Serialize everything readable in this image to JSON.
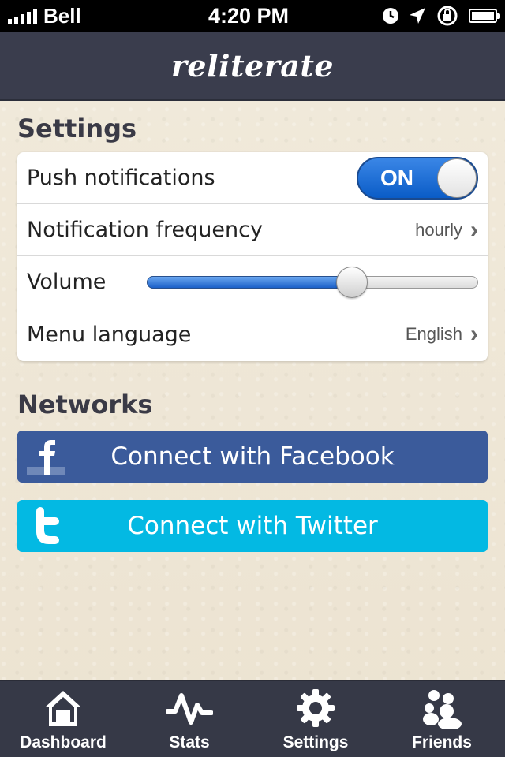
{
  "status_bar": {
    "carrier": "Bell",
    "time": "4:20 PM",
    "icons": [
      "alarm-icon",
      "location-icon",
      "rotation-lock-icon",
      "battery-icon"
    ]
  },
  "header": {
    "title": "reliterate",
    "color": "#3a3d4d"
  },
  "settings": {
    "title": "Settings",
    "push_notifications": {
      "label": "Push notifications",
      "state": "ON",
      "enabled": true
    },
    "notification_frequency": {
      "label": "Notification frequency",
      "value": "hourly"
    },
    "volume": {
      "label": "Volume",
      "level": 0.62
    },
    "menu_language": {
      "label": "Menu language",
      "value": "English"
    }
  },
  "networks": {
    "title": "Networks",
    "facebook": {
      "label": "Connect with Facebook",
      "color": "#3b5b9b",
      "icon": "facebook-icon"
    },
    "twitter": {
      "label": "Connect with Twitter",
      "color": "#03b9e3",
      "icon": "twitter-icon"
    }
  },
  "tabbar": {
    "tabs": [
      {
        "label": "Dashboard",
        "icon": "home-icon"
      },
      {
        "label": "Stats",
        "icon": "pulse-icon"
      },
      {
        "label": "Settings",
        "icon": "gear-icon",
        "active": true
      },
      {
        "label": "Friends",
        "icon": "people-icon"
      }
    ]
  }
}
